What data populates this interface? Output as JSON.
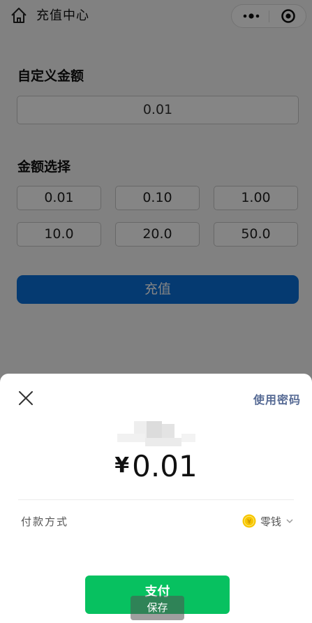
{
  "nav": {
    "title": "充值中心"
  },
  "form": {
    "custom_amount_title": "自定义金额",
    "custom_amount_value": "0.01",
    "preset_title": "金额选择",
    "presets": [
      "0.01",
      "0.10",
      "1.00",
      "10.0",
      "20.0",
      "50.0"
    ],
    "recharge_label": "充值"
  },
  "payment_sheet": {
    "use_password_label": "使用密码",
    "currency_symbol": "¥",
    "amount": "0.01",
    "method_label": "付款方式",
    "method_value": "零钱",
    "pay_label": "支付"
  },
  "save_label": "保存",
  "colors": {
    "recharge_button": "#0a6fd8",
    "pay_button": "#07c160",
    "link": "#576b95",
    "coin": "#f7c600"
  },
  "icons": {
    "home": "home-icon",
    "more": "more-icon",
    "target": "target-icon",
    "close": "close-icon",
    "coin": "coin-icon",
    "chevron": "chevron-down-icon"
  }
}
